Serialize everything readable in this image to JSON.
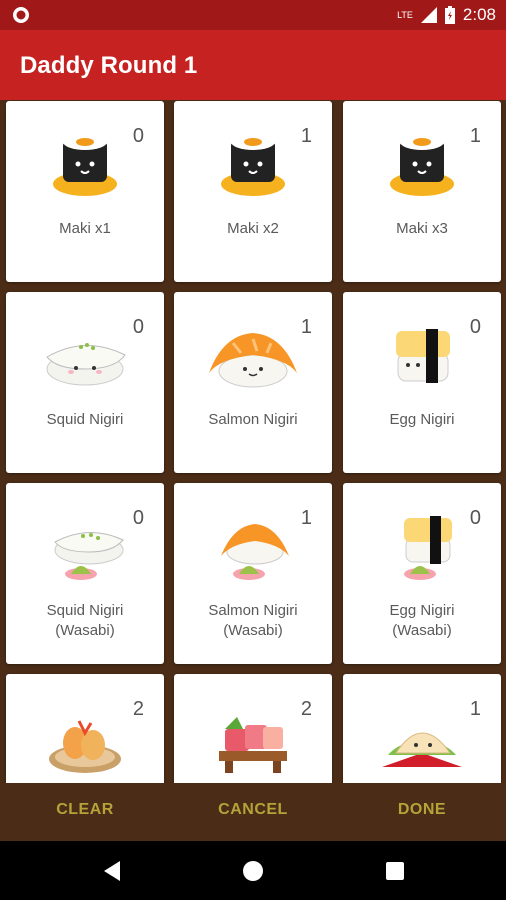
{
  "status_bar": {
    "time": "2:08",
    "network": "LTE"
  },
  "app_bar": {
    "title": "Daddy Round 1"
  },
  "cards": [
    {
      "label": "Maki x1",
      "count": "0",
      "icon": "maki-roll-icon"
    },
    {
      "label": "Maki x2",
      "count": "1",
      "icon": "maki-roll-icon"
    },
    {
      "label": "Maki x3",
      "count": "1",
      "icon": "maki-roll-icon"
    },
    {
      "label": "Squid Nigiri",
      "count": "0",
      "icon": "squid-nigiri-icon"
    },
    {
      "label": "Salmon Nigiri",
      "count": "1",
      "icon": "salmon-nigiri-icon"
    },
    {
      "label": "Egg Nigiri",
      "count": "0",
      "icon": "egg-nigiri-icon"
    },
    {
      "label": "Squid Nigiri\n(Wasabi)",
      "count": "0",
      "icon": "squid-nigiri-wasabi-icon"
    },
    {
      "label": "Salmon Nigiri\n(Wasabi)",
      "count": "1",
      "icon": "salmon-nigiri-wasabi-icon"
    },
    {
      "label": "Egg Nigiri\n(Wasabi)",
      "count": "0",
      "icon": "egg-nigiri-wasabi-icon"
    },
    {
      "label": "",
      "count": "2",
      "icon": "tempura-icon"
    },
    {
      "label": "",
      "count": "2",
      "icon": "sashimi-icon"
    },
    {
      "label": "",
      "count": "1",
      "icon": "dumpling-icon"
    }
  ],
  "actions": {
    "clear": "CLEAR",
    "cancel": "CANCEL",
    "done": "DONE"
  },
  "colors": {
    "status_bar": "#a01818",
    "app_bar": "#c62222",
    "background": "#4a2c17",
    "action_text": "#b6a238"
  }
}
